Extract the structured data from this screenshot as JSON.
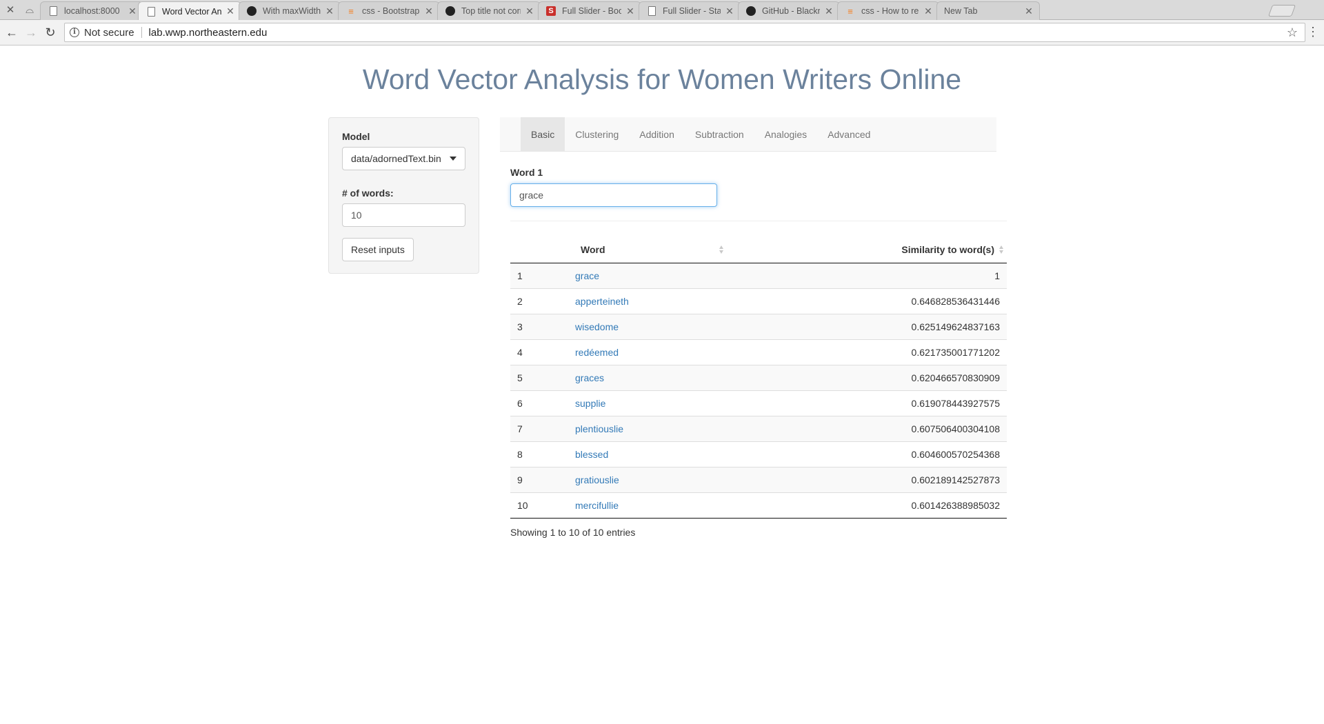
{
  "browser": {
    "tabs": [
      {
        "title": "localhost:8000",
        "favicon": "page-icon",
        "active": false
      },
      {
        "title": "Word Vector Analysis",
        "favicon": "page-icon",
        "active": true
      },
      {
        "title": "With maxWidth set on",
        "favicon": "github-icon",
        "active": false
      },
      {
        "title": "css - Bootstrap: How",
        "favicon": "stackoverflow-icon",
        "active": false
      },
      {
        "title": "Top title not correctly",
        "favicon": "github-icon",
        "active": false
      },
      {
        "title": "Full Slider - Bootstrap",
        "favicon": "startbootstrap-icon",
        "active": false
      },
      {
        "title": "Full Slider - Start Boo",
        "favicon": "page-icon",
        "active": false
      },
      {
        "title": "GitHub - BlackrockDi",
        "favicon": "github-icon",
        "active": false
      },
      {
        "title": "css - How to remove",
        "favicon": "stackoverflow-icon",
        "active": false
      },
      {
        "title": "New Tab",
        "favicon": "",
        "active": false
      }
    ],
    "security_label": "Not secure",
    "url": "lab.wwp.northeastern.edu"
  },
  "page": {
    "title": "Word Vector Analysis for Women Writers Online"
  },
  "sidebar": {
    "model_label": "Model",
    "model_value": "data/adornedText.bin",
    "count_label": "# of words:",
    "count_value": "10",
    "reset_label": "Reset inputs"
  },
  "tabs": [
    {
      "label": "Basic",
      "active": true
    },
    {
      "label": "Clustering",
      "active": false
    },
    {
      "label": "Addition",
      "active": false
    },
    {
      "label": "Subtraction",
      "active": false
    },
    {
      "label": "Analogies",
      "active": false
    },
    {
      "label": "Advanced",
      "active": false
    }
  ],
  "query": {
    "word1_label": "Word 1",
    "word1_value": "grace"
  },
  "table": {
    "headers": [
      "",
      "Word",
      "Similarity to word(s)"
    ],
    "rows": [
      {
        "index": "1",
        "word": "grace",
        "similarity": "1"
      },
      {
        "index": "2",
        "word": "apperteineth",
        "similarity": "0.646828536431446"
      },
      {
        "index": "3",
        "word": "wisedome",
        "similarity": "0.625149624837163"
      },
      {
        "index": "4",
        "word": "redéemed",
        "similarity": "0.621735001771202"
      },
      {
        "index": "5",
        "word": "graces",
        "similarity": "0.620466570830909"
      },
      {
        "index": "6",
        "word": "supplie",
        "similarity": "0.619078443927575"
      },
      {
        "index": "7",
        "word": "plentiouslie",
        "similarity": "0.607506400304108"
      },
      {
        "index": "8",
        "word": "blessed",
        "similarity": "0.604600570254368"
      },
      {
        "index": "9",
        "word": "gratiouslie",
        "similarity": "0.602189142527873"
      },
      {
        "index": "10",
        "word": "mercifullie",
        "similarity": "0.601426388985032"
      }
    ],
    "info": "Showing 1 to 10 of 10 entries"
  },
  "colors": {
    "title": "#6b829c",
    "link": "#337ab7",
    "focus": "#66afe9"
  }
}
